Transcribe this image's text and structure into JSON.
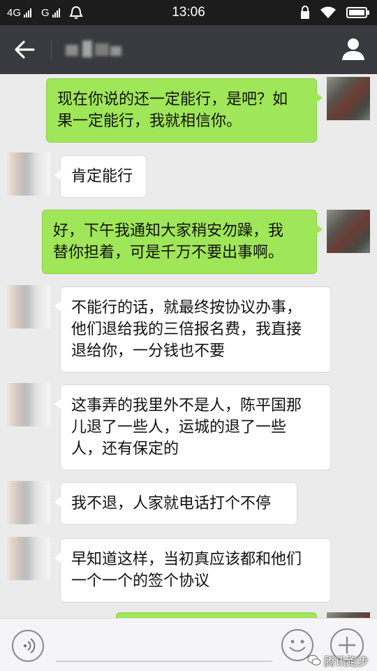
{
  "status_bar": {
    "network_1": "4G",
    "network_2": "G",
    "time": "13:06"
  },
  "header": {
    "back_icon": "arrow-left-icon",
    "profile_icon": "person-icon"
  },
  "messages": [
    {
      "side": "right",
      "text": "现在你说的还一定能行，是吧？如\n果一定能行，我就相信你。"
    },
    {
      "side": "left",
      "text": "肯定能行"
    },
    {
      "side": "right",
      "text": "好，下午我通知大家稍安勿躁，我\n替你担着，可是千万不要出事啊。"
    },
    {
      "side": "left",
      "text": "不能行的话，就最终按协议办事，\n他们退给我的三倍报名费，我直接\n退给你，一分钱也不要"
    },
    {
      "side": "left",
      "text": "这事弄的我里外不是人，陈平国那\n儿退了一些人，运城的退了一些\n人，还有保定的"
    },
    {
      "side": "left",
      "text": "我不退，人家就电话打个不停"
    },
    {
      "side": "left",
      "text": "早知道这样，当初真应该都和他们\n一个一个的签个协议"
    },
    {
      "side": "right",
      "text": ""
    }
  ],
  "input_bar": {
    "voice_icon": "voice-icon",
    "emoji_icon": "emoji-icon",
    "plus_icon": "plus-icon"
  },
  "watermark": {
    "text": "腾讯跑步"
  },
  "colors": {
    "header_bg": "#393a3f",
    "chat_bg": "#ebebeb",
    "sent_bubble": "#9fe658",
    "received_bubble": "#ffffff"
  }
}
